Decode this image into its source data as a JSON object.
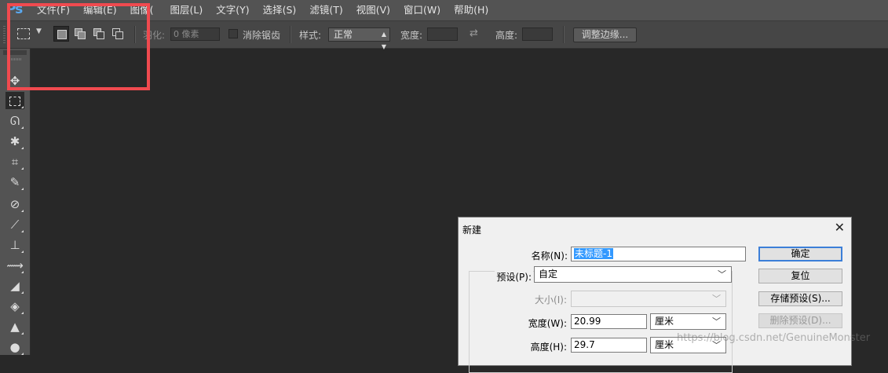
{
  "app": {
    "logo_text": "Ps"
  },
  "menubar": {
    "items": [
      "文件(F)",
      "编辑(E)",
      "图像(",
      "图层(L)",
      "文字(Y)",
      "选择(S)",
      "滤镜(T)",
      "视图(V)",
      "窗口(W)",
      "帮助(H)"
    ]
  },
  "options": {
    "feather_label": "羽化:",
    "feather_value": "0 像素",
    "antialias_label": "消除锯齿",
    "style_label": "样式:",
    "style_value": "正常",
    "width_label": "宽度:",
    "height_label": "高度:",
    "refine_edge": "调整边缘..."
  },
  "tools": [
    "move-tool",
    "marquee-tool",
    "lasso-tool",
    "magic-wand-tool",
    "crop-tool",
    "eyedropper-tool",
    "healing-brush-tool",
    "brush-tool",
    "clone-stamp-tool",
    "history-brush-tool",
    "eraser-tool",
    "paint-bucket-tool",
    "blur-tool",
    "dodge-tool"
  ],
  "dialog": {
    "title": "新建",
    "name_label": "名称(N):",
    "name_value": "未标题-1",
    "preset_label": "预设(P):",
    "preset_value": "自定",
    "size_label": "大小(I):",
    "width_label": "宽度(W):",
    "width_value": "20.99",
    "width_unit": "厘米",
    "height_label": "高度(H):",
    "height_value": "29.7",
    "height_unit": "厘米",
    "buttons": {
      "ok": "确定",
      "reset": "复位",
      "save_preset": "存储预设(S)...",
      "delete_preset": "删除预设(D)..."
    }
  },
  "watermark": "https://blog.csdn.net/GenuineMonster",
  "colors": {
    "annotation": "#f04a4f",
    "selection": "#3399ff"
  }
}
